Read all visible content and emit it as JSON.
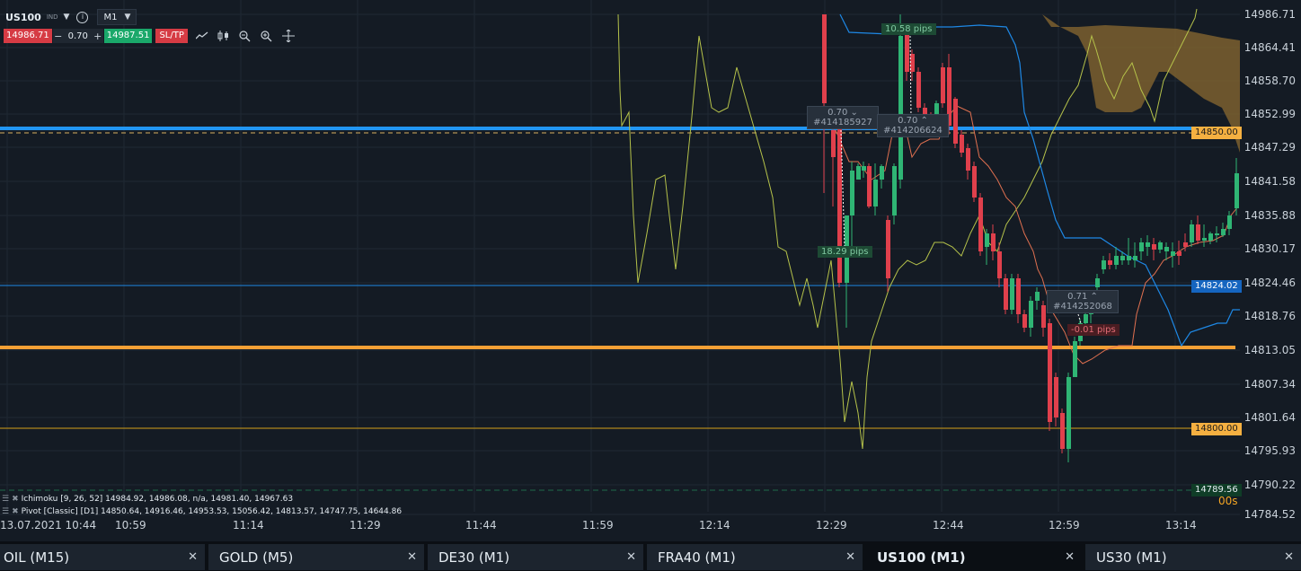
{
  "toolbar": {
    "symbol": "US100",
    "symbol_tag": "IND",
    "timeframe": "M1",
    "sell_price": "14986.71",
    "volume": "0.70",
    "buy_price": "14987.51",
    "sltp_label": "SL/TP"
  },
  "price_axis": {
    "labels": [
      "14986.71",
      "14864.41",
      "14858.70",
      "14852.99",
      "14847.29",
      "14841.58",
      "14835.88",
      "14830.17",
      "14824.46",
      "14818.76",
      "14813.05",
      "14807.34",
      "14801.64",
      "14795.93",
      "14790.22",
      "14784.52"
    ],
    "tags": {
      "pivot_pp": "14850.00",
      "ichimoku_line": "14824.02",
      "level_14800": "14800.00",
      "bid": "14789.56"
    },
    "countdown": "00s"
  },
  "time_axis": {
    "labels": [
      "13.07.2021 10:44",
      "10:59",
      "11:14",
      "11:29",
      "11:44",
      "11:59",
      "12:14",
      "12:29",
      "12:44",
      "12:59",
      "13:14"
    ]
  },
  "orders": [
    {
      "volume": "0.70",
      "id": "#414185927",
      "pips": "18.29 pips",
      "pips_sign": "positive"
    },
    {
      "volume": "0.70",
      "id": "#414206624",
      "pips": "10.58 pips",
      "pips_sign": "positive"
    },
    {
      "volume": "0.71",
      "id": "#414252068",
      "pips": "-0.01 pips",
      "pips_sign": "negative"
    }
  ],
  "indicators": [
    {
      "label": "Ichimoku [9, 26, 52] 14984.92, 14986.08, n/a, 14981.40, 14967.63"
    },
    {
      "label": "Pivot [Classic] [D1] 14850.64, 14916.46, 14953.53, 15056.42, 14813.57, 14747.75, 14644.86"
    }
  ],
  "tabs": [
    {
      "label": "OIL (M15)",
      "active": false
    },
    {
      "label": "GOLD (M5)",
      "active": false
    },
    {
      "label": "DE30 (M1)",
      "active": false
    },
    {
      "label": "FRA40 (M1)",
      "active": false
    },
    {
      "label": "US100 (M1)",
      "active": true
    },
    {
      "label": "US30 (M1)",
      "active": false
    }
  ],
  "colors": {
    "background": "#141b24",
    "bull_candle": "#2fb574",
    "bear_candle": "#e0404c",
    "pivot_line": "#2196f3",
    "s1_line": "#f5a035",
    "level_line": "#d4a017",
    "blue_line": "#1e88e5",
    "red_line": "#e07050",
    "chikou_line": "#b5c24a",
    "cloud_fill": "#8a6a30"
  }
}
